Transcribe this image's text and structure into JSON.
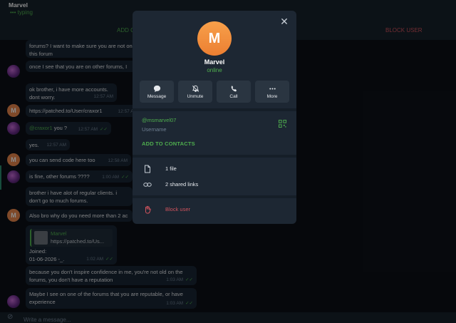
{
  "chat": {
    "title": "Marvel",
    "status": "••• typing",
    "add_contact": "ADD C",
    "block_user": "BLOCK USER",
    "composer_placeholder": "Write a message..."
  },
  "messages": [
    {
      "text": "forums? I want to make sure you are not on this forum",
      "time": ""
    },
    {
      "text": "once I see that you are on other forums, I",
      "time": ""
    },
    {
      "text": "ok brother, i have more accounts. dont worry.",
      "time": "12:57 AM"
    },
    {
      "text": "https://patched.to/User/craxor1",
      "time": "12:57 AM"
    },
    {
      "mention": "@craxor1",
      "text": " you ?",
      "time": "12:57 AM",
      "ticks": "✓✓"
    },
    {
      "text": "yes.",
      "time": "12:57 AM"
    },
    {
      "text": "you can send code here too",
      "time": "12:58 AM"
    },
    {
      "text": "is fine, other forums ????",
      "time": "1:00 AM",
      "ticks": "✓✓"
    },
    {
      "text": "brother i have alot of regular clients. i don't go to much forums.",
      "time": ""
    },
    {
      "text": "Also bro why do you need more than 2 ac",
      "time": ""
    },
    {
      "link_title": "Marvel",
      "link_url": "https://patched.to/Us...",
      "joined": "Joined:",
      "date": "01-06-2026 -_.",
      "time": "1:02 AM",
      "ticks": "✓✓"
    },
    {
      "text": "because you don't inspire confidence in me, you're not old on the forums, you don't have a reputation",
      "time": "1:03 AM",
      "ticks": "✓✓"
    },
    {
      "text": "Maybe I see on one of the forums that you are reputable, or have experience",
      "time": "1:03 AM",
      "ticks": "✓✓"
    }
  ],
  "profile": {
    "avatar_letter": "M",
    "name": "Marvel",
    "status": "online",
    "actions": [
      {
        "label": "Message",
        "icon": "message-icon"
      },
      {
        "label": "Unmute",
        "icon": "bell-off-icon"
      },
      {
        "label": "Call",
        "icon": "phone-icon"
      },
      {
        "label": "More",
        "icon": "more-icon"
      }
    ],
    "username": "@msmarvel07",
    "username_caption": "Username",
    "add_to_contacts": "ADD TO CONTACTS",
    "files": "1 file",
    "links": "2 shared links",
    "block": "Block user"
  },
  "colors": {
    "accent": "#4fae4e",
    "danger": "#d0535d",
    "avatar": "#f29444"
  }
}
